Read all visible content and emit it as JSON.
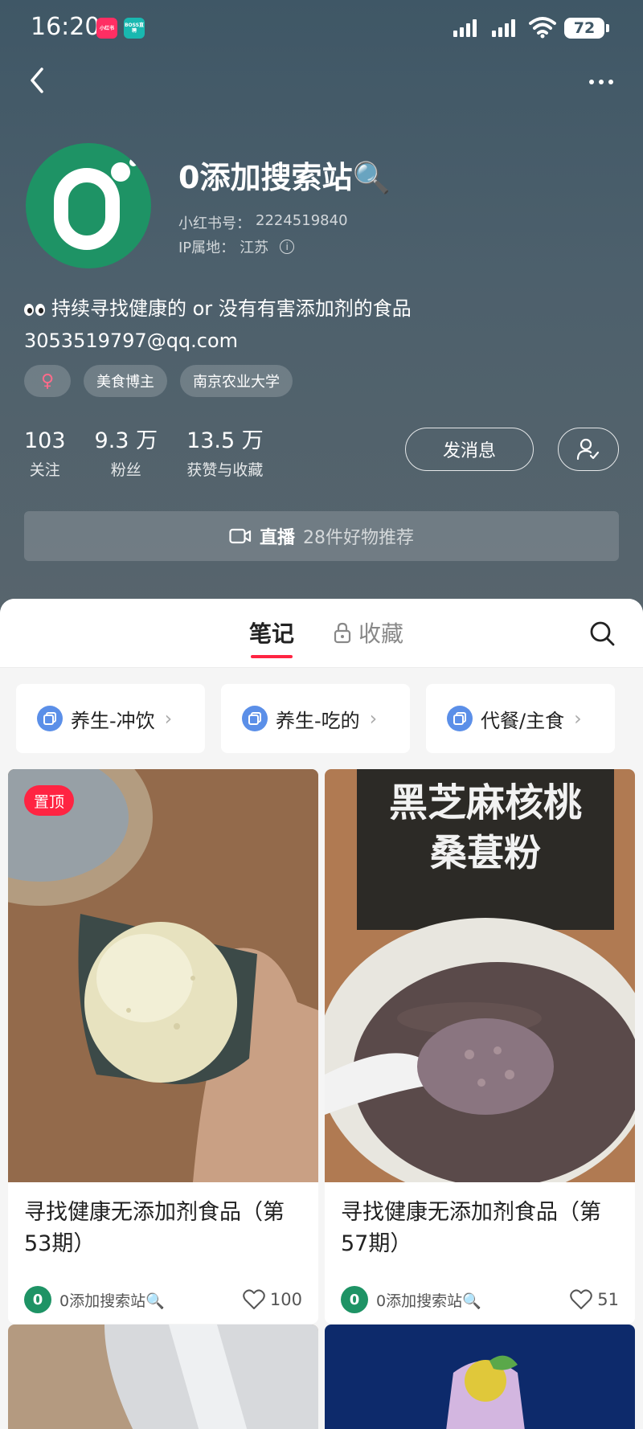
{
  "status_bar": {
    "time": "16:20",
    "badge1": "小红书",
    "badge2": "BOSS直聘",
    "battery": "72"
  },
  "profile": {
    "name": "0添加搜索站🔍",
    "red_id_label": "小红书号：",
    "red_id": "2224519840",
    "ip_label": "IP属地：",
    "ip_location": "江苏",
    "bio_line1": "持续寻找健康的 or 没有有害添加剂的食品",
    "bio_line2": "3053519797@qq.com",
    "tags": [
      "♀",
      "美食博主",
      "南京农业大学"
    ],
    "stats": [
      {
        "value": "103",
        "label": "关注"
      },
      {
        "value": "9.3 万",
        "label": "粉丝"
      },
      {
        "value": "13.5 万",
        "label": "获赞与收藏"
      }
    ],
    "message_button": "发消息"
  },
  "live": {
    "label": "直播",
    "text": "28件好物推荐"
  },
  "tabs": {
    "notes": "笔记",
    "collect": "收藏"
  },
  "collections": [
    "养生-冲饮",
    "养生-吃的",
    "代餐/主食"
  ],
  "cards": [
    {
      "pin": "置顶",
      "title": "寻找健康无添加剂食品（第53期）",
      "author": "0添加搜索站🔍",
      "likes": "100"
    },
    {
      "title": "寻找健康无添加剂食品（第57期）",
      "author": "0添加搜索站🔍",
      "likes": "51",
      "image_text1": "黑芝麻核桃",
      "image_text2": "桑葚粉"
    }
  ],
  "colors": {
    "accent": "#ff2442",
    "avatar_green": "#1e9365",
    "header_bg": "#4d606c"
  }
}
